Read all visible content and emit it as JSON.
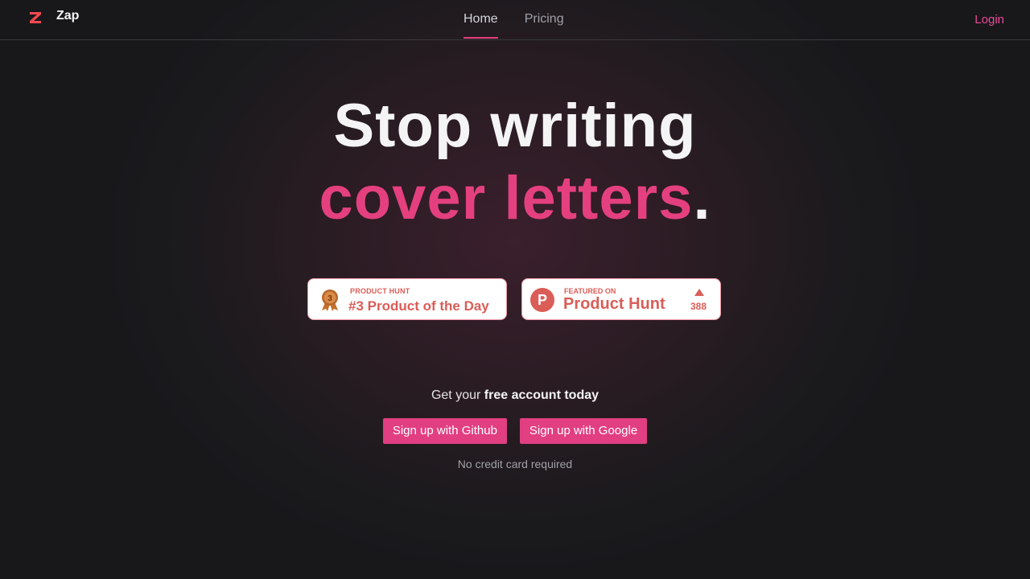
{
  "navbar": {
    "brand": "Zap",
    "logo_icon": "zap-z-logo-icon",
    "links": [
      {
        "label": "Home",
        "active": true
      },
      {
        "label": "Pricing",
        "active": false
      }
    ],
    "login_label": "Login"
  },
  "hero": {
    "line1": "Stop writing",
    "line2_highlight": "cover letters",
    "line2_end": "."
  },
  "badges": {
    "product_of_day": {
      "small": "PRODUCT HUNT",
      "big": "#3 Product of the Day",
      "medal_number": "3",
      "icon": "bronze-medal-icon"
    },
    "featured": {
      "small": "FEATURED ON",
      "big": "Product Hunt",
      "logo_letter": "P",
      "icon": "product-hunt-logo-icon",
      "votes": "388"
    }
  },
  "cta": {
    "prefix": "Get your ",
    "strong": "free account today",
    "github_button": "Sign up with Github",
    "google_button": "Sign up with Google",
    "note": "No credit card required"
  },
  "colors": {
    "accent": "#e4407f",
    "producthunt": "#da5d57",
    "background": "#18181b"
  }
}
